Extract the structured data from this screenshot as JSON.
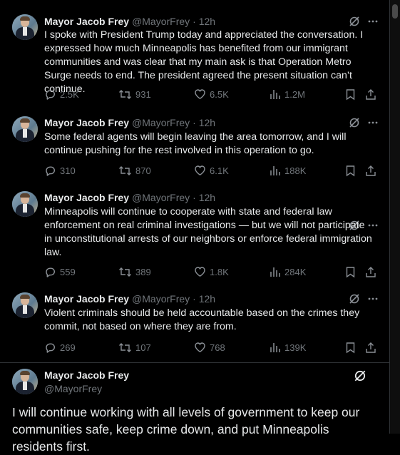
{
  "tweets": [
    {
      "author": "Mayor Jacob Frey",
      "handle": "@MayorFrey",
      "time": "· 12h",
      "text": "I spoke with President Trump today and appreciated the conversation. I expressed how much Minneapolis has benefited from our immigrant communities and was clear that my main ask is that Operation Metro Surge needs to end. The president agreed the present situation can’t continue.",
      "replies": "2.5K",
      "reposts": "931",
      "likes": "6.5K",
      "views": "1.2M"
    },
    {
      "author": "Mayor Jacob Frey",
      "handle": "@MayorFrey",
      "time": "· 12h",
      "text": "Some federal agents will begin leaving the area tomorrow, and I will continue pushing for the rest involved in this operation to go.",
      "replies": "310",
      "reposts": "870",
      "likes": "6.1K",
      "views": "188K"
    },
    {
      "author": "Mayor Jacob Frey",
      "handle": "@MayorFrey",
      "time": "· 12h",
      "text": "Minneapolis will continue to cooperate with state and federal law enforcement on real criminal investigations — but we will not participate in unconstitutional arrests of our neighbors or enforce federal immigration law.",
      "replies": "559",
      "reposts": "389",
      "likes": "1.8K",
      "views": "284K"
    },
    {
      "author": "Mayor Jacob Frey",
      "handle": "@MayorFrey",
      "time": "· 12h",
      "text": "Violent criminals should be held accountable based on the crimes they commit, not based on where they are from.",
      "replies": "269",
      "reposts": "107",
      "likes": "768",
      "views": "139K"
    }
  ],
  "focused_tweet": {
    "author": "Mayor Jacob Frey",
    "handle": "@MayorFrey",
    "text": "I will continue working with all levels of government to keep our communities safe, keep crime down, and put Minneapolis residents first."
  },
  "colors": {
    "background": "#000000",
    "text": "#e7e9ea",
    "muted": "#71767b",
    "divider": "#2f3336"
  },
  "icons": [
    "grok-icon",
    "more-icon",
    "reply-icon",
    "repost-icon",
    "like-icon",
    "views-icon",
    "bookmark-icon",
    "share-icon"
  ]
}
